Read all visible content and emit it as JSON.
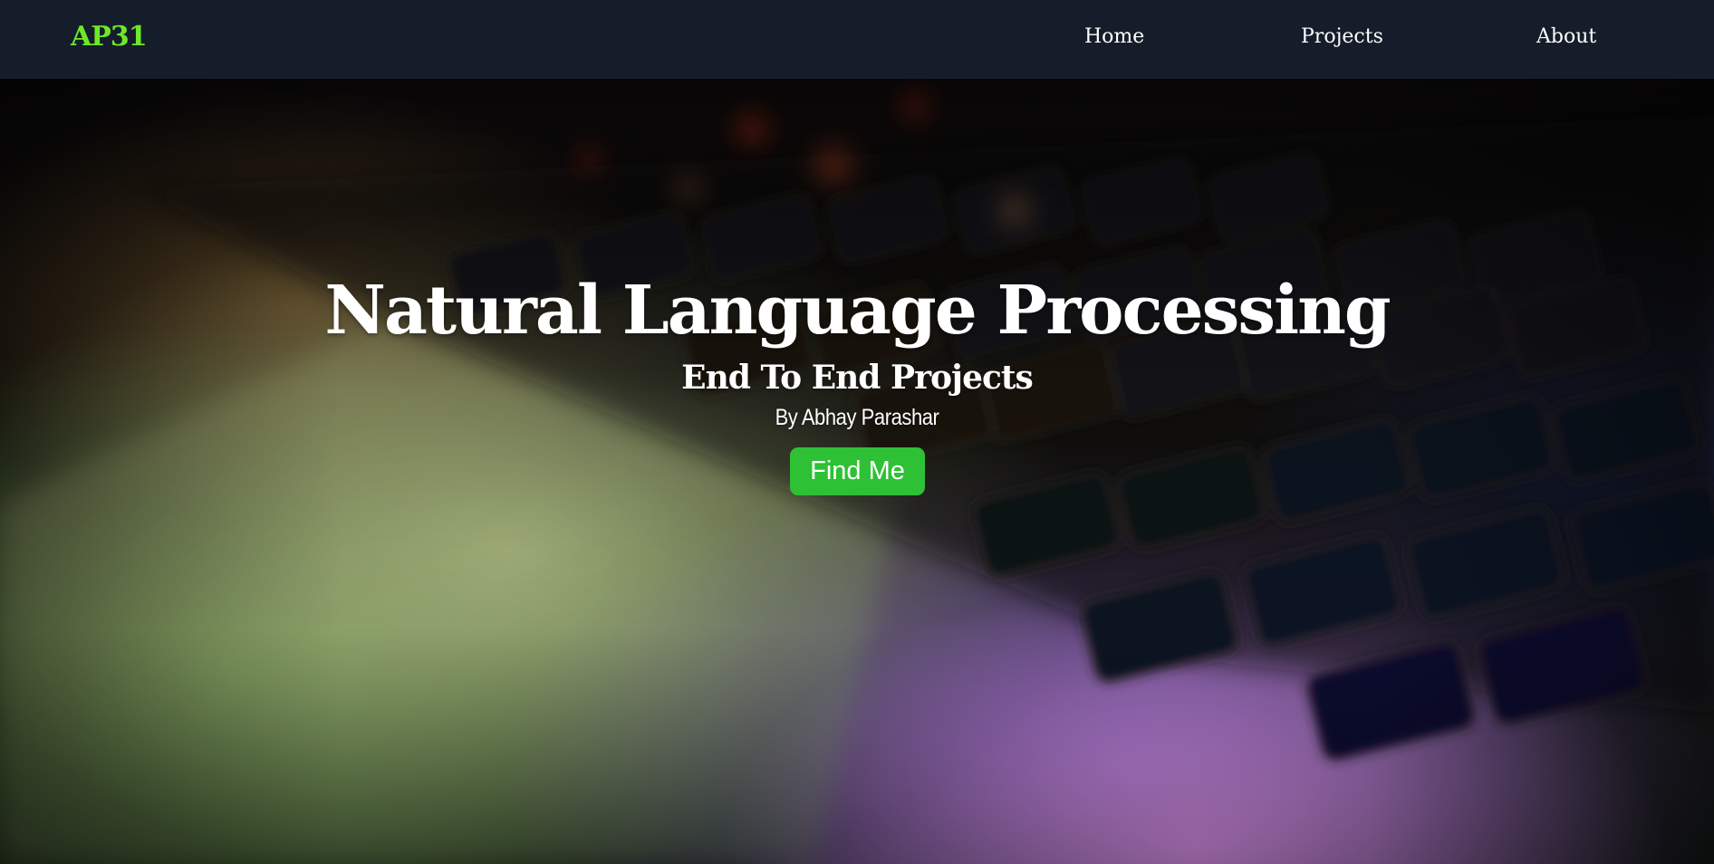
{
  "navbar": {
    "brand": "AP31",
    "links": [
      {
        "label": "Home"
      },
      {
        "label": "Projects"
      },
      {
        "label": "About"
      }
    ]
  },
  "hero": {
    "title": "Natural Language Processing",
    "subtitle": "End To End Projects",
    "author": "By Abhay Parashar",
    "button_label": "Find Me",
    "background_image": "laptop-keyboard-photo"
  },
  "colors": {
    "navbar_bg": "#161d2a",
    "brand": "#6ee82a",
    "button_bg": "#2ec135",
    "text": "#ffffff"
  }
}
